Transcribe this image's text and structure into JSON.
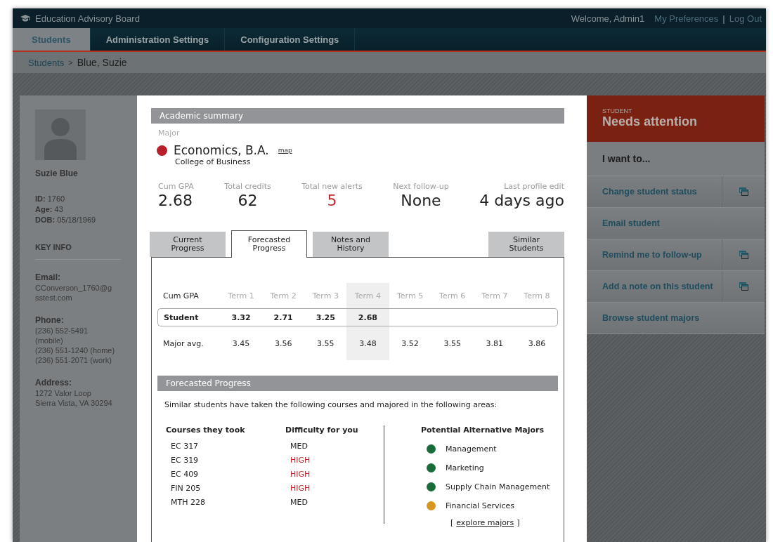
{
  "app": {
    "title": "Education Advisory Board",
    "welcome": "Welcome, Admin1",
    "links": [
      "My Preferences",
      "Log Out"
    ],
    "separator": "|"
  },
  "nav_tabs": [
    {
      "label": "Students",
      "selected": true
    },
    {
      "label": "Administration Settings",
      "selected": false
    },
    {
      "label": "Configuration Settings",
      "selected": false
    }
  ],
  "breadcrumb": {
    "link": "Students",
    "separator": ">",
    "current": "Blue, Suzie"
  },
  "profile": {
    "name": "Suzie Blue",
    "facts": [
      {
        "label": "ID:",
        "value": "1760"
      },
      {
        "label": "Age:",
        "value": "43"
      },
      {
        "label": "DOB:",
        "value": "05/18/1969"
      }
    ],
    "key_info_title": "KEY INFO",
    "sections": [
      {
        "label": "Email:",
        "lines": [
          "CConverson_1760@g",
          "sstest.com"
        ]
      },
      {
        "label": "Phone:",
        "lines": [
          "(236) 552-5491",
          "(mobile)",
          "(236) 551-1240 (home)",
          "(236) 551-2071 (work)"
        ]
      },
      {
        "label": "Address:",
        "lines": [
          "1272 Valor Loop",
          "Sierra Vista, VA 30294"
        ]
      }
    ]
  },
  "academic_summary": {
    "title": "Academic summary",
    "major_label": "Major",
    "major": {
      "name": "Economics, B.A.",
      "color": "#b8202a"
    },
    "map_link": "map",
    "college": "College of Business",
    "stats": [
      {
        "label": "Cum GPA",
        "value": "2.68",
        "color": "#222222"
      },
      {
        "label": "Total credits",
        "value": "62",
        "color": "#222222"
      },
      {
        "label": "Total new alerts",
        "value": "5",
        "color": "#c0282d"
      },
      {
        "label": "Next follow-up",
        "value": "None",
        "color": "#222222"
      },
      {
        "label": "Last profile edit",
        "value": "4 days ago",
        "color": "#222222"
      }
    ]
  },
  "content_tabs": [
    {
      "label": "Current Progress",
      "selected": false
    },
    {
      "label": "Forecasted Progress",
      "selected": true
    },
    {
      "label": "Notes and History",
      "selected": false
    },
    {
      "label": "Similar Students",
      "selected": false
    }
  ],
  "gpa_table": {
    "corner": "Cum GPA",
    "columns": [
      {
        "label": "Term 1",
        "current": false
      },
      {
        "label": "Term 2",
        "current": false
      },
      {
        "label": "Term 3",
        "current": false
      },
      {
        "label": "Term 4",
        "current": true
      },
      {
        "label": "Term 5",
        "current": false
      },
      {
        "label": "Term 6",
        "current": false
      },
      {
        "label": "Term 7",
        "current": false
      },
      {
        "label": "Term 8",
        "current": false
      }
    ],
    "rows": [
      {
        "label": "Student",
        "kind": "student",
        "values": [
          "3.32",
          "2.71",
          "3.25",
          "2.68"
        ]
      },
      {
        "label": "Major avg.",
        "kind": "average",
        "values": [
          "3.45",
          "3.56",
          "3.55",
          "3.48",
          "3.52",
          "3.55",
          "3.81",
          "3.86"
        ]
      }
    ]
  },
  "forecast": {
    "title": "Forecasted Progress",
    "intro": "Similar students have taken the following courses and majored in the following areas:",
    "courses_heading": "Courses they took",
    "difficulty_heading": "Difficulty for you",
    "courses": [
      {
        "course": "EC 317",
        "difficulty": "MED",
        "color": "#222222"
      },
      {
        "course": "EC 319",
        "difficulty": "HIGH",
        "color": "#c0282d"
      },
      {
        "course": "EC 409",
        "difficulty": "HIGH",
        "color": "#c0282d"
      },
      {
        "course": "FIN 205",
        "difficulty": "HIGH",
        "color": "#c0282d"
      },
      {
        "course": "MTH 228",
        "difficulty": "MED",
        "color": "#222222"
      }
    ],
    "majors_heading": "Potential Alternative Majors",
    "majors": [
      {
        "name": "Management",
        "color": "#1a6b3a"
      },
      {
        "name": "Marketing",
        "color": "#1a6b3a"
      },
      {
        "name": "Supply Chain Management",
        "color": "#1a6b3a"
      },
      {
        "name": "Financial Services",
        "color": "#d9961e"
      }
    ],
    "explore": {
      "open": "[",
      "link": "explore majors",
      "close": "]"
    }
  },
  "status_card": {
    "label": "STUDENT",
    "status": "Needs attention"
  },
  "actions": {
    "title": "I want to...",
    "items": [
      {
        "label": "Change student status",
        "opens_window": true
      },
      {
        "label": "Email student",
        "opens_window": false
      },
      {
        "label": "Remind me to follow-up",
        "opens_window": true
      },
      {
        "label": "Add a note on this student",
        "opens_window": true
      },
      {
        "label": "Browse student majors",
        "opens_window": false
      }
    ]
  }
}
